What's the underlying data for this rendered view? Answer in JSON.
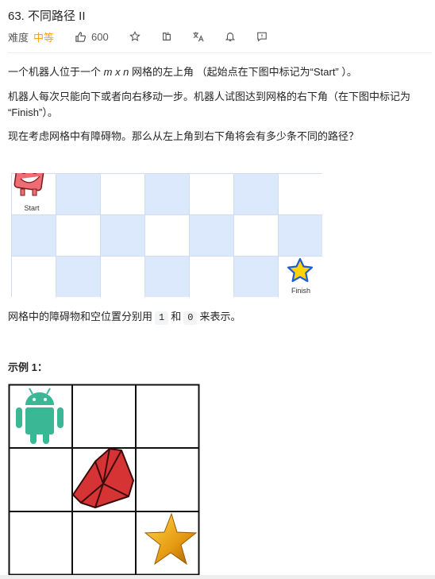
{
  "problem": {
    "title": "63. 不同路径 II",
    "difficulty_label": "难度",
    "difficulty": "中等",
    "likes": "600"
  },
  "colors": {
    "difficulty": "#ffa116",
    "grid_blue": "#dce8fb",
    "grid_line": "#d0dcef",
    "star_fill": "#ffd400",
    "star_stroke": "#1e5cd6"
  },
  "toolbar_icons": [
    "thumbs-up-icon",
    "star-icon",
    "share-icon",
    "translate-icon",
    "bell-icon",
    "feedback-icon"
  ],
  "description": {
    "p1_prefix": "一个机器人位于一个 ",
    "p1_var": "m x n",
    "p1_suffix": " 网格的左上角 （起始点在下图中标记为“Start” ）。",
    "p2_line1": "机器人每次只能向下或者向右移动一步。机器人试图达到网格的右下角（在下图中标记为",
    "p2_line2": "“Finish”）。",
    "p3": "现在考虑网格中有障碍物。那么从左上角到右下角将会有多少条不同的路径？",
    "p4_prefix": "网格中的障碍物和空位置分别用",
    "p4_code1": "1",
    "p4_and": "和",
    "p4_code2": "0",
    "p4_suffix": "来表示。"
  },
  "figure": {
    "start_label": "Start",
    "finish_label": "Finish",
    "rows": 3,
    "cols": 7
  },
  "example": {
    "title": "示例 1："
  }
}
